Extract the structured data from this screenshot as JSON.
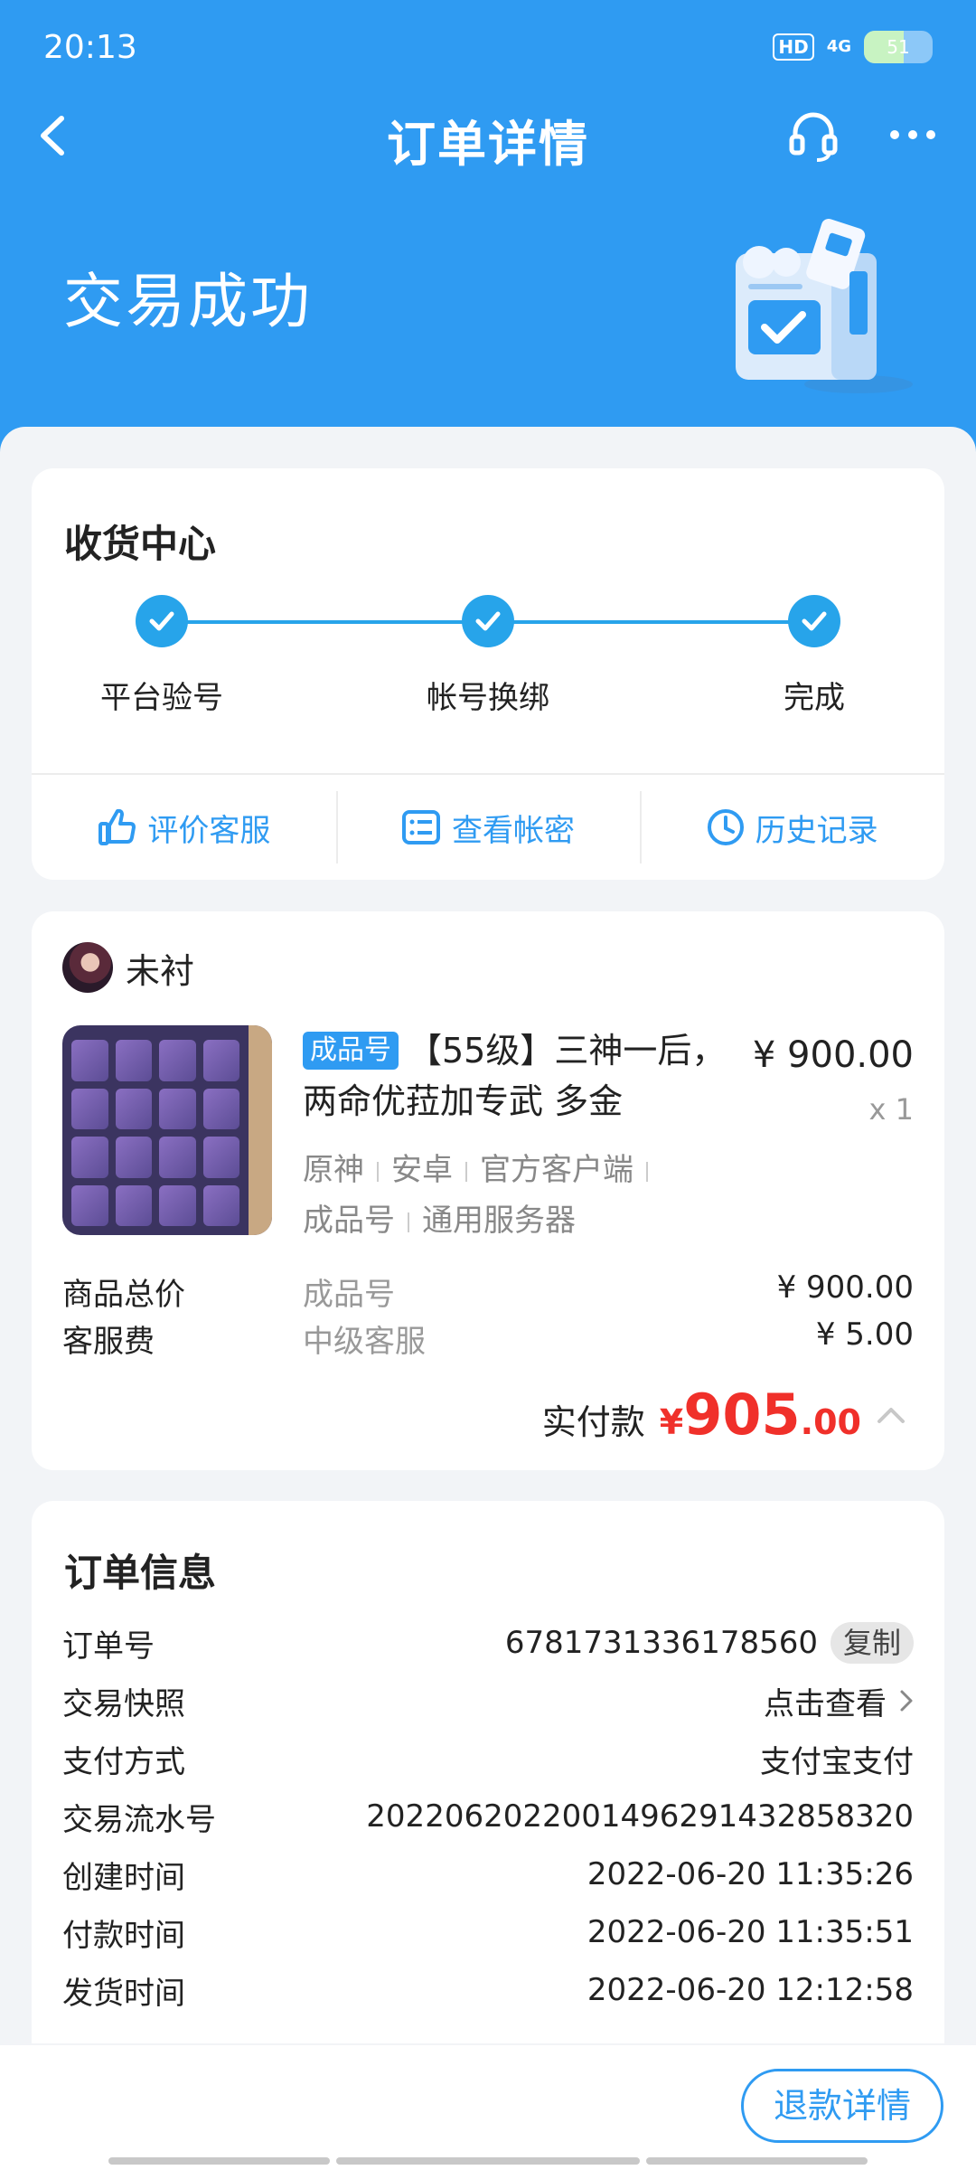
{
  "status_bar": {
    "time": "20:13",
    "hd": "HD",
    "network": "4G",
    "battery": "51"
  },
  "nav": {
    "title": "订单详情"
  },
  "order_status": {
    "title": "交易成功"
  },
  "receipt": {
    "title": "收货中心",
    "steps": [
      "平台验号",
      "帐号换绑",
      "完成"
    ],
    "actions": [
      "评价客服",
      "查看帐密",
      "历史记录"
    ]
  },
  "goods": {
    "seller": "未衬",
    "tag": "成品号",
    "title": "【55级】三神一后，两命优菈加专武 多金",
    "price": "¥ 900.00",
    "qty": "x 1",
    "attrs_line1": [
      "原神",
      "安卓",
      "官方客户端"
    ],
    "attrs_line2": [
      "成品号",
      "通用服务器"
    ],
    "fees": [
      {
        "label": "商品总价",
        "mid": "成品号",
        "value": "¥ 900.00"
      },
      {
        "label": "客服费",
        "mid": "中级客服",
        "value": "¥ 5.00"
      }
    ],
    "total_label": "实付款",
    "total_currency": "¥",
    "total_int": "905",
    "total_dec": ".00"
  },
  "order_info": {
    "title": "订单信息",
    "rows": [
      {
        "label": "订单号",
        "value": "6781731336178560",
        "button": "复制"
      },
      {
        "label": "交易快照",
        "value": "点击查看"
      },
      {
        "label": "支付方式",
        "value": "支付宝支付"
      },
      {
        "label": "交易流水号",
        "value": "2022062022001496291432858320"
      },
      {
        "label": "创建时间",
        "value": "2022-06-20 11:35:26"
      },
      {
        "label": "付款时间",
        "value": "2022-06-20 11:35:51"
      },
      {
        "label": "发货时间",
        "value": "2022-06-20 12:12:58"
      }
    ]
  },
  "bottom": {
    "refund_label": "退款详情"
  },
  "colors": {
    "primary": "#2f9bf2",
    "price_red": "#f0302a",
    "step_blue": "#27a4ea"
  }
}
